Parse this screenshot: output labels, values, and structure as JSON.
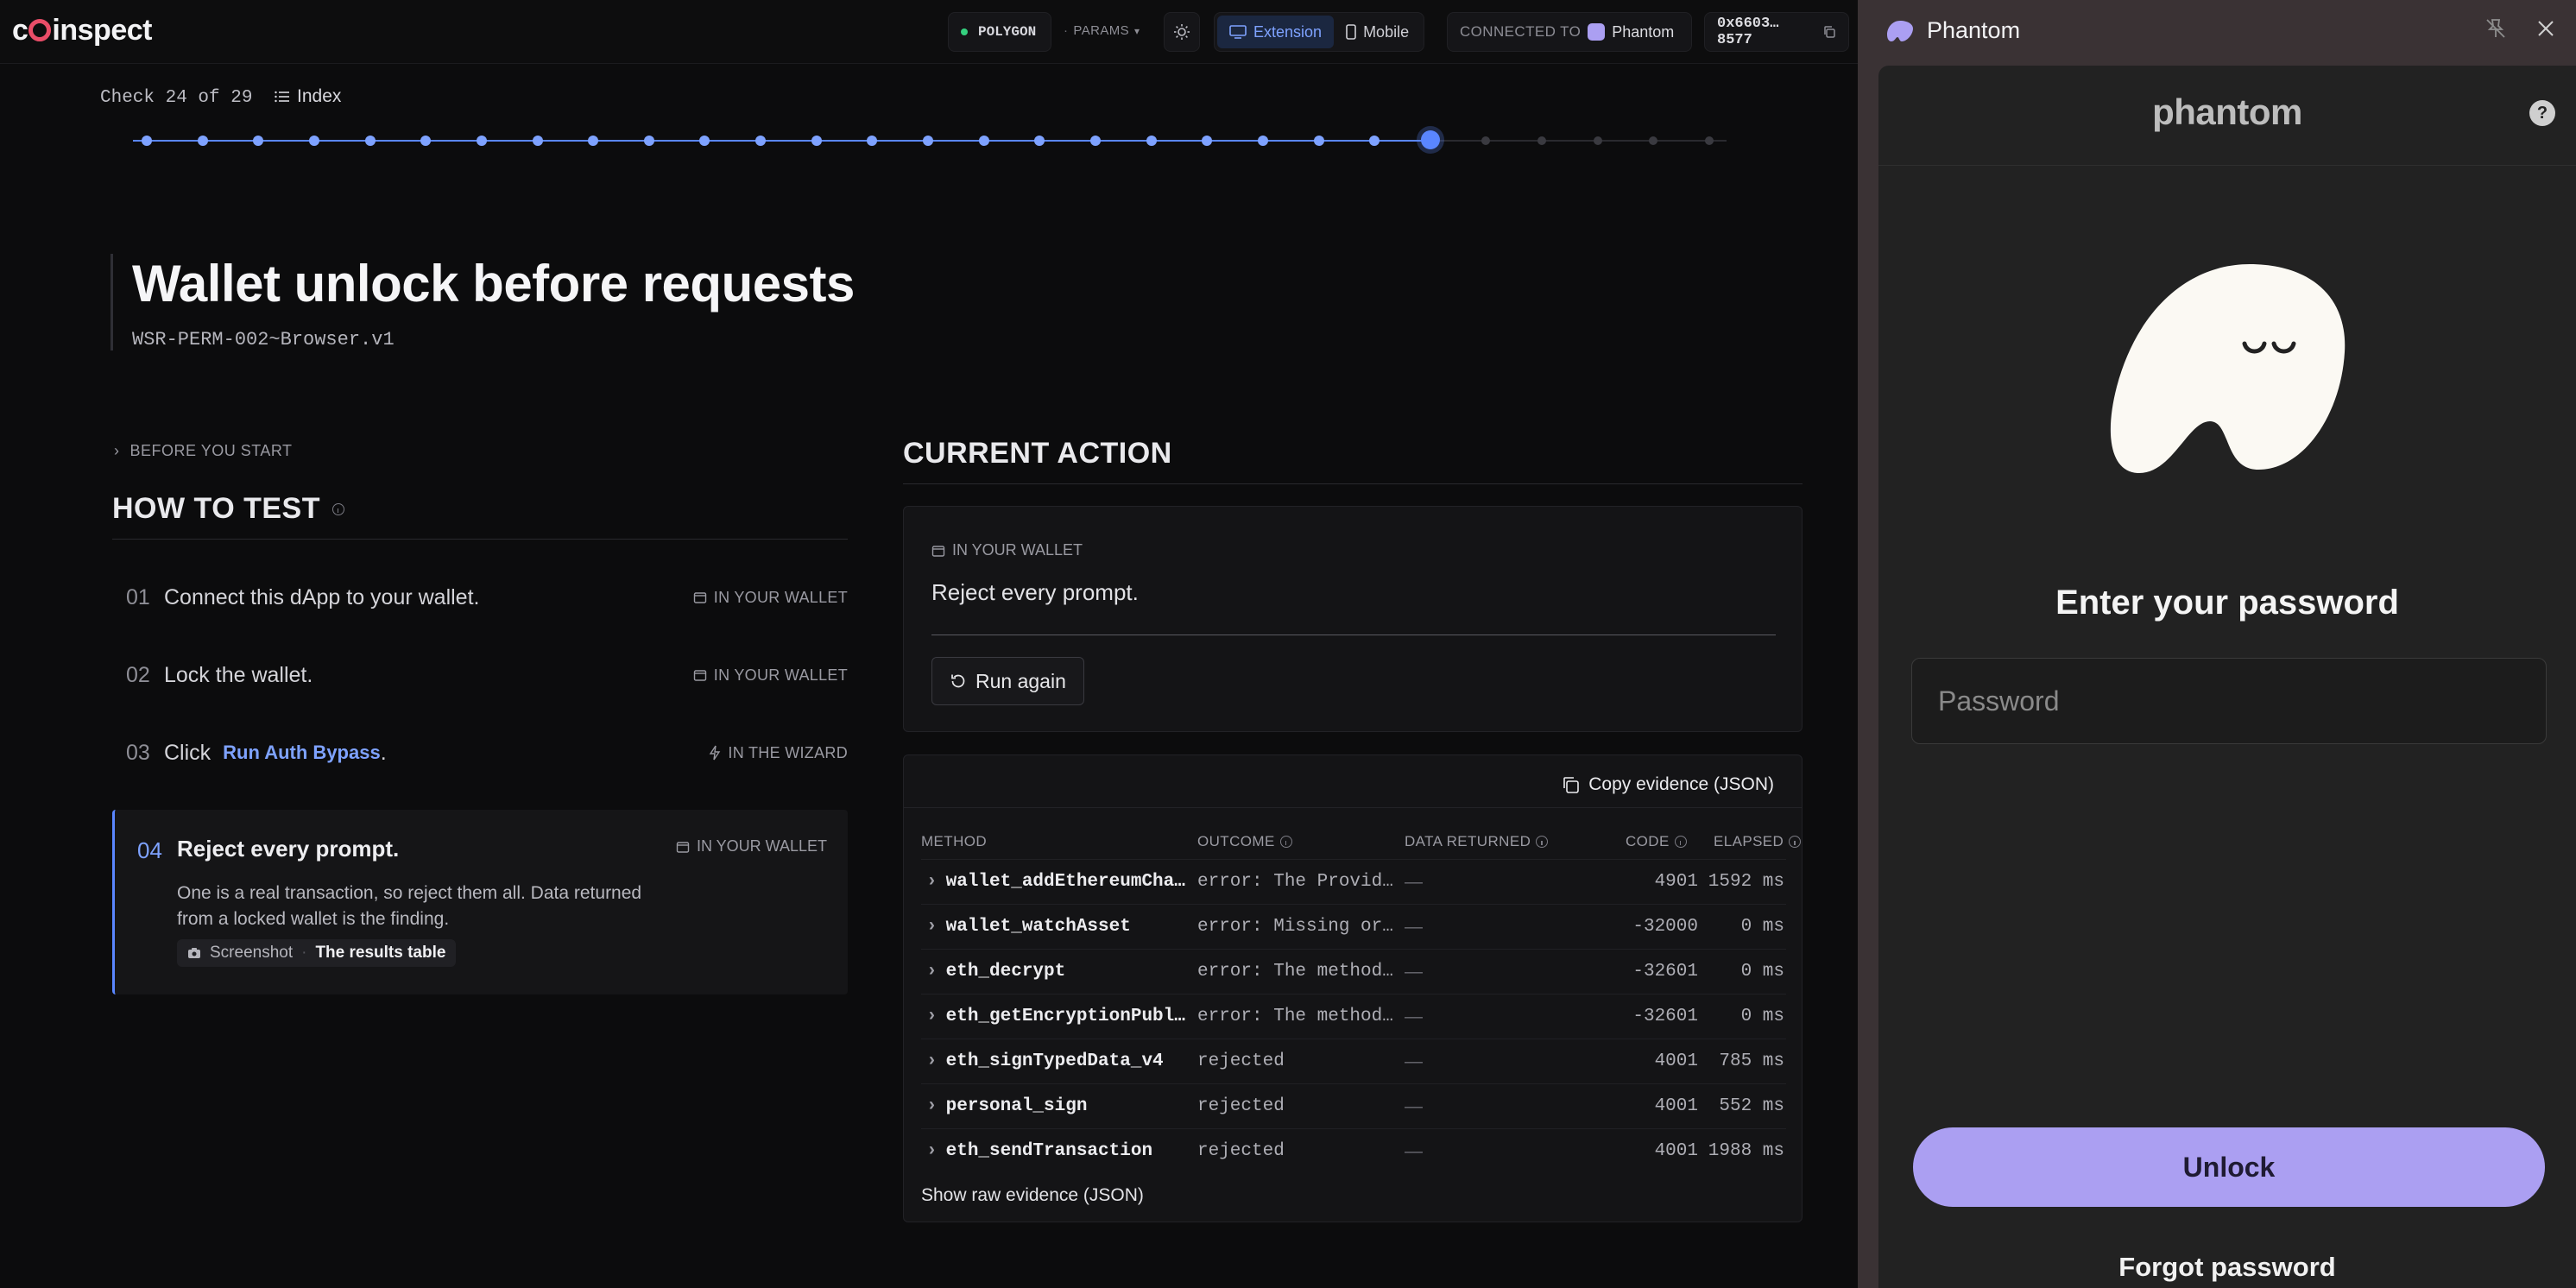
{
  "app": {
    "logo": "c◎inspect",
    "logo_pre": "c",
    "logo_post": "inspect",
    "network": "POLYGON",
    "params": "PARAMS",
    "mode_extension": "Extension",
    "mode_mobile": "Mobile",
    "connected_label": "CONNECTED TO",
    "connected_wallet": "Phantom",
    "address": "0x6603…8577"
  },
  "progress": {
    "label": "Check 24 of 29",
    "index_label": "Index",
    "current": 24,
    "total": 29
  },
  "check": {
    "title": "Wallet unlock before requests",
    "id": "WSR-PERM-002~Browser.v1"
  },
  "before_label": "BEFORE YOU START",
  "how_to_test": {
    "heading": "HOW TO TEST",
    "steps": [
      {
        "num": "01",
        "text": "Connect this dApp to your wallet.",
        "tag": "IN YOUR WALLET"
      },
      {
        "num": "02",
        "text": "Lock the wallet.",
        "tag": "IN YOUR WALLET"
      },
      {
        "num": "03",
        "text": "Click",
        "link": "Run Auth Bypass",
        "suffix": ".",
        "tag": "IN THE WIZARD"
      },
      {
        "num": "04",
        "text": "Reject every prompt.",
        "tag": "IN YOUR WALLET",
        "desc": "One is a real transaction, so reject them all. Data returned from a locked wallet is the finding.",
        "chip_a": "Screenshot",
        "chip_sep": "·",
        "chip_b": "The results table"
      }
    ]
  },
  "current_action": {
    "heading": "CURRENT ACTION",
    "tag": "IN YOUR WALLET",
    "text": "Reject every prompt.",
    "button": "Run again"
  },
  "results": {
    "copy_label": "Copy evidence (JSON)",
    "columns": {
      "method": "METHOD",
      "outcome": "OUTCOME",
      "data": "DATA RETURNED",
      "code": "CODE",
      "elapsed": "ELAPSED"
    },
    "rows": [
      {
        "method": "wallet_addEthereumCha…",
        "outcome": "error: The Provid…",
        "data": "—",
        "code": "4901",
        "elapsed": "1592 ms"
      },
      {
        "method": "wallet_watchAsset",
        "outcome": "error: Missing or…",
        "data": "—",
        "code": "-32000",
        "elapsed": "0 ms"
      },
      {
        "method": "eth_decrypt",
        "outcome": "error: The method…",
        "data": "—",
        "code": "-32601",
        "elapsed": "0 ms"
      },
      {
        "method": "eth_getEncryptionPubl…",
        "outcome": "error: The method…",
        "data": "—",
        "code": "-32601",
        "elapsed": "0 ms"
      },
      {
        "method": "eth_signTypedData_v4",
        "outcome": "rejected",
        "data": "—",
        "code": "4001",
        "elapsed": "785 ms"
      },
      {
        "method": "personal_sign",
        "outcome": "rejected",
        "data": "—",
        "code": "4001",
        "elapsed": "552 ms"
      },
      {
        "method": "eth_sendTransaction",
        "outcome": "rejected",
        "data": "—",
        "code": "4001",
        "elapsed": "1988 ms"
      }
    ],
    "raw_label": "Show raw evidence (JSON)"
  },
  "phantom": {
    "window_title": "Phantom",
    "wordmark": "phantom",
    "help": "?",
    "heading": "Enter your password",
    "password_placeholder": "Password",
    "unlock": "Unlock",
    "forgot": "Forgot password"
  },
  "colors": {
    "accent": "#5a86ff",
    "phantom_button": "#ab9ff2",
    "network_dot": "#35d07f"
  }
}
